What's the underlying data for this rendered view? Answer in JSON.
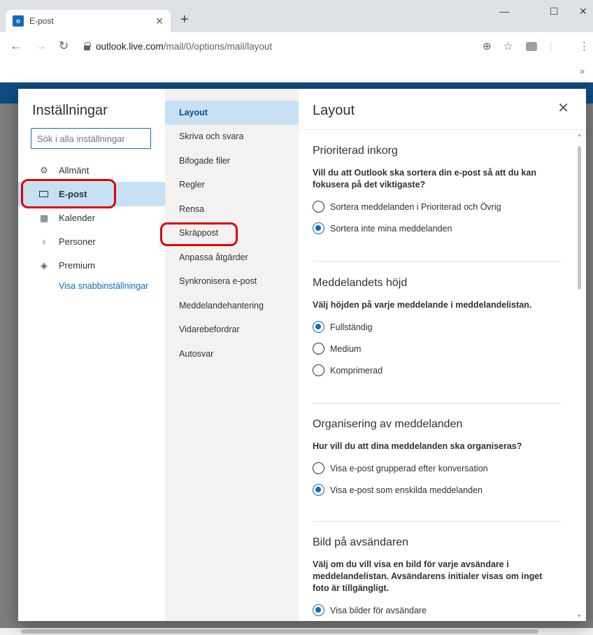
{
  "browser": {
    "tab_title": "E-post",
    "tab_favicon": "o",
    "new_tab": "+",
    "url_host": "outlook.live.com",
    "url_path": "/mail/0/options/mail/layout",
    "bookmarks_overflow": "»"
  },
  "settings": {
    "title": "Inställningar",
    "search_placeholder": "Sök i alla inställningar",
    "categories": [
      {
        "label": "Allmänt",
        "icon": "gear-icon",
        "glyph": "⚙"
      },
      {
        "label": "E-post",
        "icon": "mail-icon",
        "glyph": ""
      },
      {
        "label": "Kalender",
        "icon": "calendar-icon",
        "glyph": "▦"
      },
      {
        "label": "Personer",
        "icon": "people-icon",
        "glyph": "♁"
      },
      {
        "label": "Premium",
        "icon": "diamond-icon",
        "glyph": "◈"
      }
    ],
    "quick_settings_link": "Visa snabbinställningar"
  },
  "mail_nav": {
    "items": [
      "Layout",
      "Skriva och svara",
      "Bifogade filer",
      "Regler",
      "Rensa",
      "Skräppost",
      "Anpassa åtgärder",
      "Synkronisera e-post",
      "Meddelandehantering",
      "Vidarebefordrar",
      "Autosvar"
    ]
  },
  "panel": {
    "title": "Layout",
    "sections": [
      {
        "title": "Prioriterad inkorg",
        "question": "Vill du att Outlook ska sortera din e-post så att du kan fokusera på det viktigaste?",
        "options": [
          "Sortera meddelanden i Prioriterad och Övrig",
          "Sortera inte mina meddelanden"
        ],
        "selected": 1
      },
      {
        "title": "Meddelandets höjd",
        "question": "Välj höjden på varje meddelande i meddelandelistan.",
        "options": [
          "Fullständig",
          "Medium",
          "Komprimerad"
        ],
        "selected": 0
      },
      {
        "title": "Organisering av meddelanden",
        "question": "Hur vill du att dina meddelanden ska organiseras?",
        "options": [
          "Visa e-post grupperad efter konversation",
          "Visa e-post som enskilda meddelanden"
        ],
        "selected": 1
      },
      {
        "title": "Bild på avsändaren",
        "question": "Välj om du vill visa en bild för varje avsändare i meddelandelistan. Avsändarens initialer visas om inget foto är tillgängligt.",
        "options": [
          "Visa bilder för avsändare"
        ],
        "selected": 0
      }
    ]
  }
}
